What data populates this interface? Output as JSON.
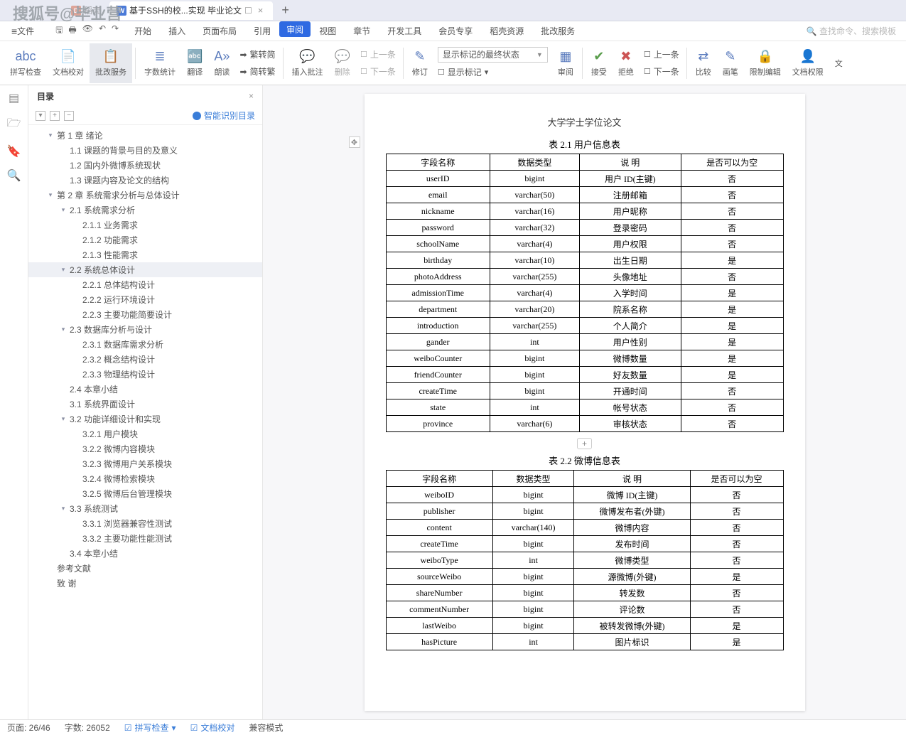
{
  "watermark": "搜狐号@毕业营",
  "tabs": {
    "ghost": "稻壳",
    "active": "基于SSH的校...实现 毕业论文"
  },
  "menu": {
    "file": "文件",
    "items": [
      "开始",
      "插入",
      "页面布局",
      "引用",
      "审阅",
      "视图",
      "章节",
      "开发工具",
      "会员专享",
      "稻壳资源",
      "批改服务"
    ],
    "active_idx": 4,
    "search": "查找命令、搜索模板"
  },
  "ribbon": {
    "spell": "拼写检查",
    "proof": "文档校对",
    "grade": "批改服务",
    "wc": "字数统计",
    "trans": "翻译",
    "read": "朗读",
    "s2t": "繁转简",
    "t2s": "简转繁",
    "ins": "插入批注",
    "del": "删除",
    "prev": "上一条",
    "next": "下一条",
    "fix": "修订",
    "combo": "显示标记的最终状态",
    "mark": "显示标记",
    "pane": "审阅",
    "accept": "接受",
    "reject": "拒绝",
    "pnav": "上一条",
    "nnav": "下一条",
    "compare": "比较",
    "ink": "画笔",
    "restrict": "限制编辑",
    "perm": "文档权限",
    "more": "文"
  },
  "outline": {
    "title": "目录",
    "smart": "智能识别目录",
    "tree": [
      {
        "d": 1,
        "t": "第 1 章  绪论",
        "tw": 1
      },
      {
        "d": 2,
        "t": "1.1  课题的背景与目的及意义"
      },
      {
        "d": 2,
        "t": "1.2  国内外微博系统现状"
      },
      {
        "d": 2,
        "t": "1.3  课题内容及论文的结构"
      },
      {
        "d": 1,
        "t": "第 2 章  系统需求分析与总体设计",
        "tw": 1
      },
      {
        "d": 2,
        "t": "2.1  系统需求分析",
        "tw": 1
      },
      {
        "d": 3,
        "t": "2.1.1  业务需求"
      },
      {
        "d": 3,
        "t": "2.1.2  功能需求"
      },
      {
        "d": 3,
        "t": "2.1.3  性能需求"
      },
      {
        "d": 2,
        "t": "2.2  系统总体设计",
        "tw": 1,
        "sel": 1
      },
      {
        "d": 3,
        "t": "2.2.1  总体结构设计"
      },
      {
        "d": 3,
        "t": "2.2.2  运行环境设计"
      },
      {
        "d": 3,
        "t": "2.2.3  主要功能简要设计"
      },
      {
        "d": 2,
        "t": "2.3  数据库分析与设计",
        "tw": 1
      },
      {
        "d": 3,
        "t": "2.3.1  数据库需求分析"
      },
      {
        "d": 3,
        "t": "2.3.2  概念结构设计"
      },
      {
        "d": 3,
        "t": "2.3.3  物理结构设计"
      },
      {
        "d": 2,
        "t": "2.4  本章小结"
      },
      {
        "d": 2,
        "t": "3.1  系统界面设计"
      },
      {
        "d": 2,
        "t": "3.2  功能详细设计和实现",
        "tw": 1
      },
      {
        "d": 3,
        "t": "3.2.1  用户模块"
      },
      {
        "d": 3,
        "t": "3.2.2  微博内容模块"
      },
      {
        "d": 3,
        "t": "3.2.3  微博用户关系模块"
      },
      {
        "d": 3,
        "t": "3.2.4  微博检索模块"
      },
      {
        "d": 3,
        "t": "3.2.5  微博后台管理模块"
      },
      {
        "d": 2,
        "t": "3.3  系统测试",
        "tw": 1
      },
      {
        "d": 3,
        "t": "3.3.1  浏览器兼容性测试"
      },
      {
        "d": 3,
        "t": "3.3.2  主要功能性能测试"
      },
      {
        "d": 2,
        "t": "3.4  本章小结"
      },
      {
        "d": 1,
        "t": "参考文献"
      },
      {
        "d": 1,
        "t": "致      谢"
      }
    ]
  },
  "doc": {
    "header": "大学学士学位论文",
    "cap1": "表 2.1  用户信息表",
    "cap2": "表 2.2  微博信息表",
    "t1": {
      "h": [
        "字段名称",
        "数据类型",
        "说      明",
        "是否可以为空"
      ],
      "rows": [
        [
          "userID",
          "bigint",
          "用户 ID(主键)",
          "否"
        ],
        [
          "email",
          "varchar(50)",
          "注册邮箱",
          "否"
        ],
        [
          "nickname",
          "varchar(16)",
          "用户昵称",
          "否"
        ],
        [
          "password",
          "varchar(32)",
          "登录密码",
          "否"
        ],
        [
          "schoolName",
          "varchar(4)",
          "用户权限",
          "否"
        ],
        [
          "birthday",
          "varchar(10)",
          "出生日期",
          "是"
        ],
        [
          "photoAddress",
          "varchar(255)",
          "头像地址",
          "否"
        ],
        [
          "admissionTime",
          "varchar(4)",
          "入学时间",
          "是"
        ],
        [
          "department",
          "varchar(20)",
          "院系名称",
          "是"
        ],
        [
          "introduction",
          "varchar(255)",
          "个人简介",
          "是"
        ],
        [
          "gander",
          "int",
          "用户性别",
          "是"
        ],
        [
          "weiboCounter",
          "bigint",
          "微博数量",
          "是"
        ],
        [
          "friendCounter",
          "bigint",
          "好友数量",
          "是"
        ],
        [
          "createTime",
          "bigint",
          "开通时间",
          "否"
        ],
        [
          "state",
          "int",
          "帐号状态",
          "否"
        ],
        [
          "province",
          "varchar(6)",
          "审核状态",
          "否"
        ]
      ]
    },
    "t2": {
      "h": [
        "字段名称",
        "数据类型",
        "说      明",
        "是否可以为空"
      ],
      "rows": [
        [
          "weiboID",
          "bigint",
          "微博 ID(主键)",
          "否"
        ],
        [
          "publisher",
          "bigint",
          "微博发布者(外键)",
          "否"
        ],
        [
          "content",
          "varchar(140)",
          "微博内容",
          "否"
        ],
        [
          "createTime",
          "bigint",
          "发布时间",
          "否"
        ],
        [
          "weiboType",
          "int",
          "微博类型",
          "否"
        ],
        [
          "sourceWeibo",
          "bigint",
          "源微博(外键)",
          "是"
        ],
        [
          "shareNumber",
          "bigint",
          "转发数",
          "否"
        ],
        [
          "commentNumber",
          "bigint",
          "评论数",
          "否"
        ],
        [
          "lastWeibo",
          "bigint",
          "被转发微博(外键)",
          "是"
        ],
        [
          "hasPicture",
          "int",
          "图片标识",
          "是"
        ]
      ]
    }
  },
  "status": {
    "page": "页面: 26/46",
    "words": "字数: 26052",
    "spell": "拼写检查",
    "proof": "文档校对",
    "compat": "兼容模式"
  }
}
